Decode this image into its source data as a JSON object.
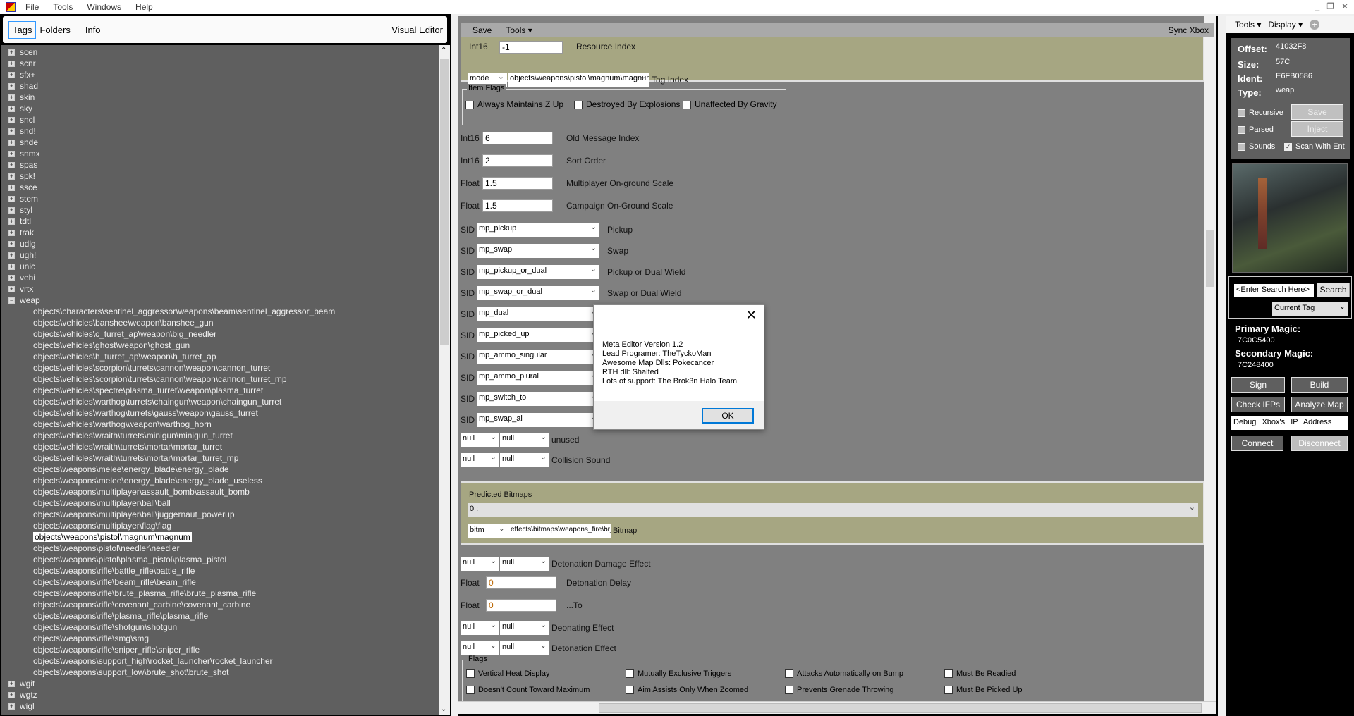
{
  "menu": [
    "File",
    "Tools",
    "Windows",
    "Help"
  ],
  "left": {
    "tabs": [
      "Tags",
      "Folders",
      "Info"
    ],
    "visual_editor": "Visual Editor",
    "top_nodes": [
      "scen",
      "scnr",
      "sfx+",
      "shad",
      "skin",
      "sky",
      "sncl",
      "snd!",
      "snde",
      "snmx",
      "spas",
      "spk!",
      "ssce",
      "stem",
      "styl",
      "tdtl",
      "trak",
      "udlg",
      "ugh!",
      "unic",
      "vehi",
      "vrtx"
    ],
    "expanded_node": "weap",
    "weap_children": [
      "objects\\characters\\sentinel_aggressor\\weapons\\beam\\sentinel_aggressor_beam",
      "objects\\vehicles\\banshee\\weapon\\banshee_gun",
      "objects\\vehicles\\c_turret_ap\\weapon\\big_needler",
      "objects\\vehicles\\ghost\\weapon\\ghost_gun",
      "objects\\vehicles\\h_turret_ap\\weapon\\h_turret_ap",
      "objects\\vehicles\\scorpion\\turrets\\cannon\\weapon\\cannon_turret",
      "objects\\vehicles\\scorpion\\turrets\\cannon\\weapon\\cannon_turret_mp",
      "objects\\vehicles\\spectre\\plasma_turret\\weapon\\plasma_turret",
      "objects\\vehicles\\warthog\\turrets\\chaingun\\weapon\\chaingun_turret",
      "objects\\vehicles\\warthog\\turrets\\gauss\\weapon\\gauss_turret",
      "objects\\vehicles\\warthog\\weapon\\warthog_horn",
      "objects\\vehicles\\wraith\\turrets\\minigun\\minigun_turret",
      "objects\\vehicles\\wraith\\turrets\\mortar\\mortar_turret",
      "objects\\vehicles\\wraith\\turrets\\mortar\\mortar_turret_mp",
      "objects\\weapons\\melee\\energy_blade\\energy_blade",
      "objects\\weapons\\melee\\energy_blade\\energy_blade_useless",
      "objects\\weapons\\multiplayer\\assault_bomb\\assault_bomb",
      "objects\\weapons\\multiplayer\\ball\\ball",
      "objects\\weapons\\multiplayer\\ball\\juggernaut_powerup",
      "objects\\weapons\\multiplayer\\flag\\flag",
      "objects\\weapons\\pistol\\magnum\\magnum",
      "objects\\weapons\\pistol\\needler\\needler",
      "objects\\weapons\\pistol\\plasma_pistol\\plasma_pistol",
      "objects\\weapons\\rifle\\battle_rifle\\battle_rifle",
      "objects\\weapons\\rifle\\beam_rifle\\beam_rifle",
      "objects\\weapons\\rifle\\brute_plasma_rifle\\brute_plasma_rifle",
      "objects\\weapons\\rifle\\covenant_carbine\\covenant_carbine",
      "objects\\weapons\\rifle\\plasma_rifle\\plasma_rifle",
      "objects\\weapons\\rifle\\shotgun\\shotgun",
      "objects\\weapons\\rifle\\smg\\smg",
      "objects\\weapons\\rifle\\sniper_rifle\\sniper_rifle",
      "objects\\weapons\\support_high\\rocket_launcher\\rocket_launcher",
      "objects\\weapons\\support_low\\brute_shot\\brute_shot"
    ],
    "selected_child": "objects\\weapons\\pistol\\magnum\\magnum",
    "bottom_nodes": [
      "wgit",
      "wgtz",
      "wigl"
    ]
  },
  "editor": {
    "toolbar": {
      "save": "Save",
      "tools": "Tools",
      "sync": "Sync Xbox"
    },
    "resource": {
      "type": "Int16",
      "value": "-1",
      "label": "Resource Index"
    },
    "tag_index": {
      "class": "mode",
      "path": "objects\\weapons\\pistol\\magnum\\magnum",
      "label": "Tag Index"
    },
    "item_flags": {
      "title": "Item Flags",
      "items": [
        "Always Maintains Z Up",
        "Destroyed By Explosions",
        "Unaffected By Gravity"
      ]
    },
    "fields": [
      {
        "type": "Int16",
        "value": "6",
        "label": "Old Message Index"
      },
      {
        "type": "Int16",
        "value": "2",
        "label": "Sort Order"
      },
      {
        "type": "Float",
        "value": "1.5",
        "label": "Multiplayer On-ground Scale"
      },
      {
        "type": "Float",
        "value": "1.5",
        "label": "Campaign On-Ground Scale"
      }
    ],
    "sids": [
      {
        "type": "SID",
        "value": "mp_pickup",
        "label": "Pickup"
      },
      {
        "type": "SID",
        "value": "mp_swap",
        "label": "Swap"
      },
      {
        "type": "SID",
        "value": "mp_pickup_or_dual",
        "label": "Pickup or Dual Wield"
      },
      {
        "type": "SID",
        "value": "mp_swap_or_dual",
        "label": "Swap or Dual Wield"
      },
      {
        "type": "SID",
        "value": "mp_dual"
      },
      {
        "type": "SID",
        "value": "mp_picked_up"
      },
      {
        "type": "SID",
        "value": "mp_ammo_singular"
      },
      {
        "type": "SID",
        "value": "mp_ammo_plural"
      },
      {
        "type": "SID",
        "value": "mp_switch_to"
      },
      {
        "type": "SID",
        "value": "mp_swap_ai"
      }
    ],
    "refs1": [
      {
        "a": "null",
        "b": "null",
        "label": "unused"
      },
      {
        "a": "null",
        "b": "null",
        "label": "Collision Sound"
      }
    ],
    "predicted": {
      "title": "Predicted Bitmaps",
      "index": "0 :",
      "class": "bitm",
      "path": "effects\\bitmaps\\weapons_fire\\br_muzzle_flash_long",
      "label": "Bitmap"
    },
    "lower": [
      {
        "kind": "ref",
        "a": "null",
        "b": "null",
        "label": "Detonation Damage Effect"
      },
      {
        "kind": "val",
        "type": "Float",
        "value": "0",
        "label": "Detonation Delay"
      },
      {
        "kind": "val",
        "type": "Float",
        "value": "0",
        "label": "...To"
      },
      {
        "kind": "ref",
        "a": "null",
        "b": "null",
        "label": "Deonating Effect"
      },
      {
        "kind": "ref",
        "a": "null",
        "b": "null",
        "label": "Detonation Effect"
      }
    ],
    "flags": {
      "title": "Flags",
      "items": [
        "Vertical Heat Display",
        "Mutually Exclusive Triggers",
        "Attacks Automatically on Bump",
        "Must Be Readied",
        "Doesn't Count Toward Maximum",
        "Aim Assists Only When Zoomed",
        "Prevents Grenade Throwing",
        "Must Be Picked Up"
      ]
    }
  },
  "dialog": {
    "lines": [
      "Meta Editor Version 1.2",
      "Lead Programer: TheTyckoMan",
      "Awesome Map Dlls: Pokecancer",
      "RTH dll: Shalted",
      "Lots of support: The Brok3n Halo Team"
    ],
    "ok": "OK"
  },
  "right": {
    "toolbar": {
      "tools": "Tools",
      "display": "Display"
    },
    "info": {
      "offset_label": "Offset:",
      "offset": "41032F8",
      "size_label": "Size:",
      "size": "57C",
      "ident_label": "Ident:",
      "ident": "E6FB0586",
      "type_label": "Type:",
      "type": "weap"
    },
    "checks": {
      "recursive": "Recursive",
      "parsed": "Parsed",
      "sounds": "Sounds",
      "scan": "Scan With Ent"
    },
    "scan_checked": true,
    "buttons": {
      "save": "Save",
      "inject": "Inject",
      "sign": "Sign",
      "build": "Build",
      "check_ifps": "Check IFPs",
      "analyze": "Analyze Map",
      "connect": "Connect",
      "disconnect": "Disconnect"
    },
    "search": {
      "placeholder": "<Enter Search Here>",
      "button": "Search",
      "scope": "Current Tag"
    },
    "primary_label": "Primary Magic:",
    "primary": "7C0C5400",
    "secondary_label": "Secondary Magic:",
    "secondary": "7C248400",
    "debug_ip": "Debug Xbox's IP Address"
  }
}
